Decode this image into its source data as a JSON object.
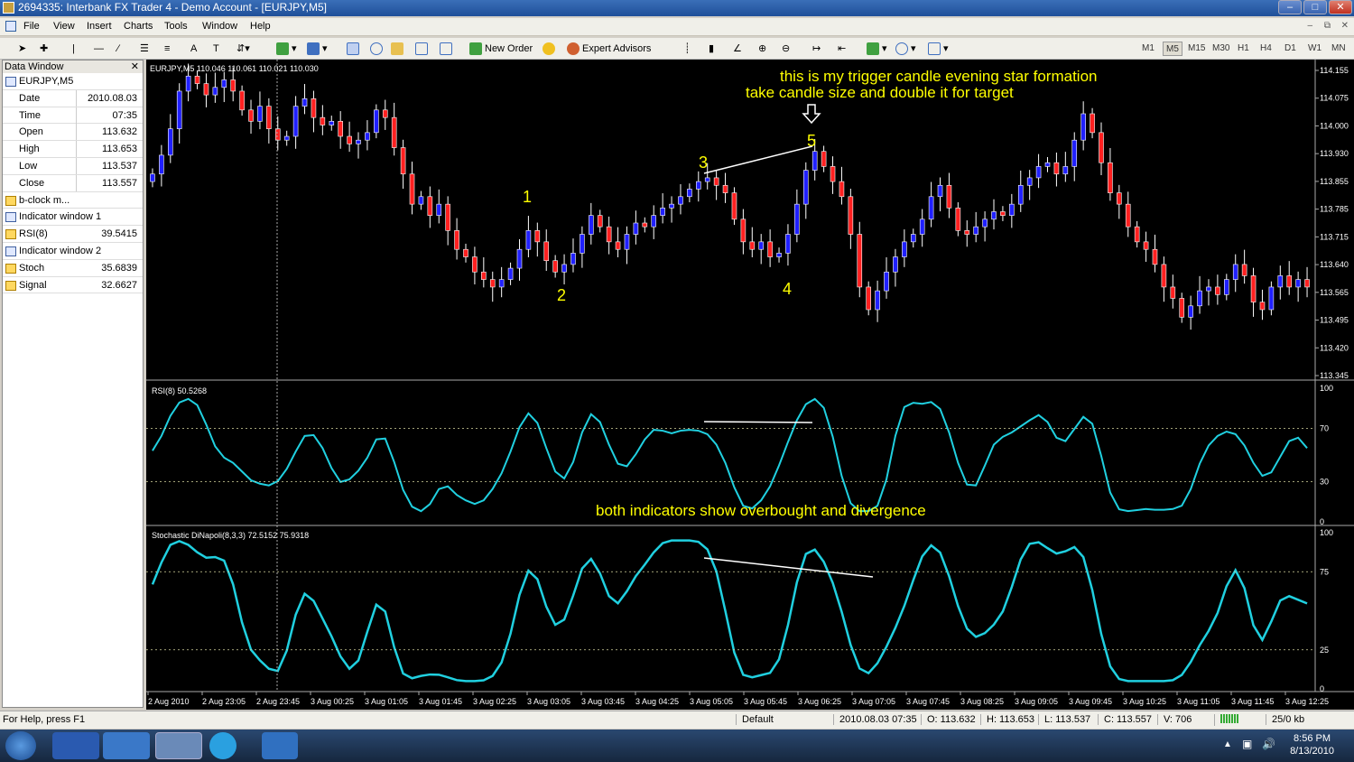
{
  "window": {
    "title": "2694335: Interbank FX Trader 4 - Demo Account - [EURJPY,M5]"
  },
  "menu": [
    "File",
    "View",
    "Insert",
    "Charts",
    "Tools",
    "Window",
    "Help"
  ],
  "toolbar": {
    "new_order": "New Order",
    "expert_advisors": "Expert Advisors",
    "timeframes": [
      "M1",
      "M5",
      "M15",
      "M30",
      "H1",
      "H4",
      "D1",
      "W1",
      "MN"
    ],
    "selected_tf": "M5"
  },
  "data_window": {
    "title": "Data Window",
    "rows": [
      {
        "name": "EURJPY,M5",
        "value": "",
        "icon": "chart-icon"
      },
      {
        "name": "Date",
        "value": "2010.08.03"
      },
      {
        "name": "Time",
        "value": "07:35"
      },
      {
        "name": "Open",
        "value": "113.632"
      },
      {
        "name": "High",
        "value": "113.653"
      },
      {
        "name": "Low",
        "value": "113.537"
      },
      {
        "name": "Close",
        "value": "113.557"
      },
      {
        "name": "b-clock m...",
        "value": "",
        "icon": "indicator-icon"
      },
      {
        "name": "Indicator window 1",
        "value": "",
        "icon": "chart-icon"
      },
      {
        "name": "RSI(8)",
        "value": "39.5415",
        "icon": "indicator-icon"
      },
      {
        "name": "Indicator window 2",
        "value": "",
        "icon": "chart-icon"
      },
      {
        "name": "Stoch",
        "value": "35.6839",
        "icon": "indicator-icon"
      },
      {
        "name": "Signal",
        "value": "32.6627",
        "icon": "indicator-icon"
      }
    ]
  },
  "chart": {
    "header": "EURJPY,M5  110.046 110.061 110.021 110.030",
    "annotations": {
      "trigger": "this is my trigger candle  evening star formation",
      "target": "take candle size and double it for target",
      "indicators": "both indicators show overbought and divergence",
      "points": [
        "1",
        "2",
        "3",
        "4",
        "5"
      ]
    },
    "price_levels": [
      "114.155",
      "114.075",
      "114.000",
      "113.930",
      "113.855",
      "113.785",
      "113.715",
      "113.640",
      "113.565",
      "113.495",
      "113.420",
      "113.345"
    ],
    "rsi_header": "RSI(8) 50.5268",
    "rsi_levels": [
      "100",
      "70",
      "30",
      "0"
    ],
    "stoch_header": "Stochastic DiNapoli(8,3,3) 72.5152 75.9318",
    "stoch_levels": [
      "100",
      "75",
      "25",
      "0"
    ],
    "time_labels": [
      "2 Aug 2010",
      "2 Aug 23:05",
      "2 Aug 23:45",
      "3 Aug 00:25",
      "3 Aug 01:05",
      "3 Aug 01:45",
      "3 Aug 02:25",
      "3 Aug 03:05",
      "3 Aug 03:45",
      "3 Aug 04:25",
      "3 Aug 05:05",
      "3 Aug 05:45",
      "3 Aug 06:25",
      "3 Aug 07:05",
      "3 Aug 07:45",
      "3 Aug 08:25",
      "3 Aug 09:05",
      "3 Aug 09:45",
      "3 Aug 10:25",
      "3 Aug 11:05",
      "3 Aug 11:45",
      "3 Aug 12:25"
    ],
    "colors": {
      "bull": "#2020ff",
      "bear": "#ff2020",
      "wick": "#ffffff",
      "indicator": "#20d0e0",
      "level": "#d8d8a0",
      "annotation": "#ffff00"
    },
    "close_series": [
      113.88,
      113.93,
      114.0,
      114.1,
      114.14,
      114.12,
      114.09,
      114.11,
      114.13,
      114.1,
      114.05,
      114.02,
      114.06,
      114.0,
      113.97,
      113.98,
      114.06,
      114.08,
      114.03,
      114.01,
      114.02,
      113.98,
      113.96,
      113.97,
      113.99,
      114.05,
      114.03,
      113.95,
      113.88,
      113.8,
      113.82,
      113.77,
      113.8,
      113.73,
      113.68,
      113.66,
      113.62,
      113.6,
      113.58,
      113.6,
      113.63,
      113.68,
      113.73,
      113.7,
      113.65,
      113.62,
      113.64,
      113.67,
      113.72,
      113.77,
      113.74,
      113.7,
      113.68,
      113.72,
      113.75,
      113.74,
      113.77,
      113.79,
      113.8,
      113.82,
      113.84,
      113.86,
      113.87,
      113.85,
      113.83,
      113.76,
      113.7,
      113.68,
      113.7,
      113.66,
      113.67,
      113.72,
      113.8,
      113.89,
      113.94,
      113.9,
      113.86,
      113.82,
      113.72,
      113.58,
      113.52,
      113.57,
      113.62,
      113.66,
      113.7,
      113.72,
      113.76,
      113.82,
      113.85,
      113.79,
      113.73,
      113.72,
      113.74,
      113.76,
      113.78,
      113.77,
      113.8,
      113.85,
      113.87,
      113.9,
      113.91,
      113.88,
      113.9,
      113.97,
      114.04,
      113.99,
      113.91,
      113.83,
      113.8,
      113.74,
      113.7,
      113.68,
      113.64,
      113.58,
      113.55,
      113.5,
      113.53,
      113.57,
      113.58,
      113.56,
      113.6,
      113.64,
      113.61,
      113.54,
      113.52,
      113.58,
      113.61,
      113.58,
      113.6,
      113.58
    ]
  }
}
